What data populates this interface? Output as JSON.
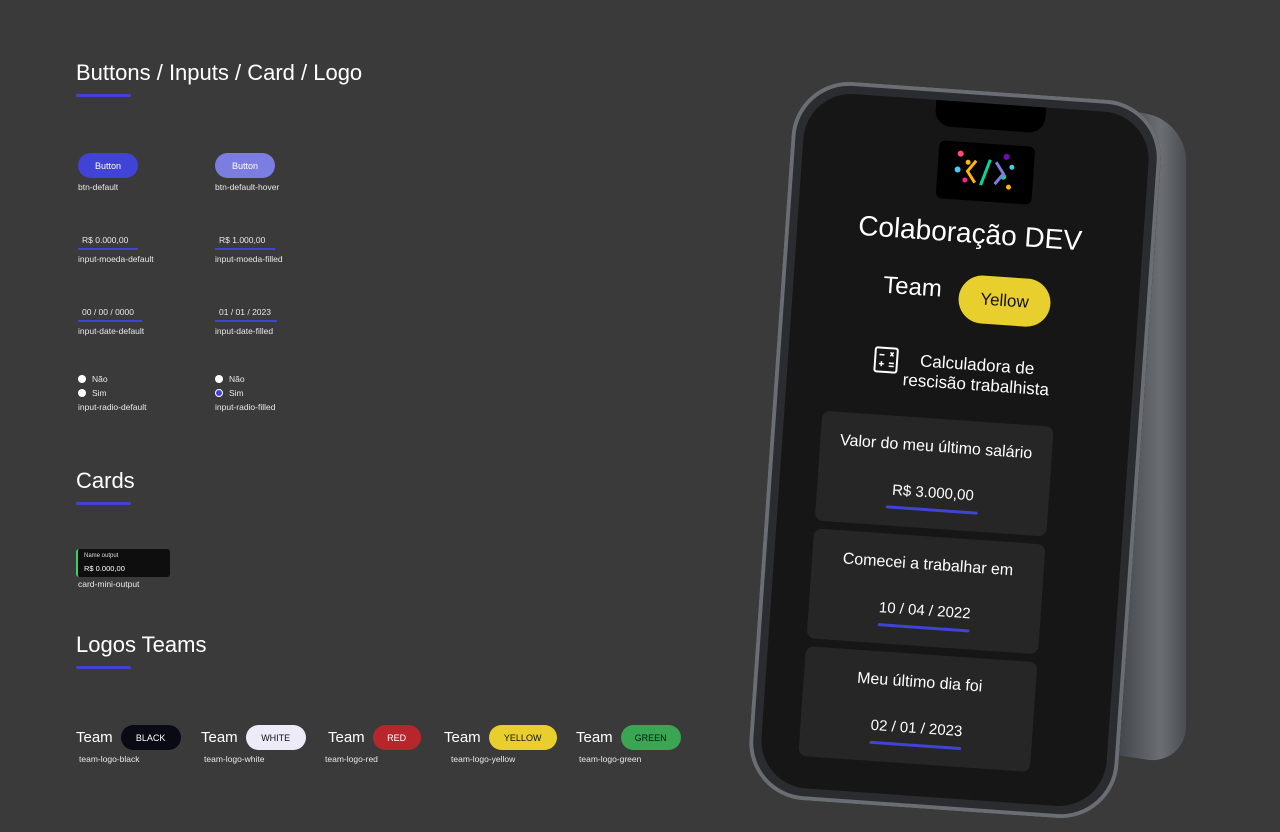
{
  "sections": {
    "buttons_inputs": "Buttons / Inputs / Card / Logo",
    "cards": "Cards",
    "logos_teams": "Logos Teams"
  },
  "buttons": {
    "default": {
      "text": "Button",
      "label": "btn-default",
      "color": "#4043d6"
    },
    "hover": {
      "text": "Button",
      "label": "btn-default-hover",
      "color": "#7b7de0"
    }
  },
  "inputs": {
    "moeda_default": {
      "value": "R$   0.000,00",
      "label": "input-moeda-default"
    },
    "moeda_filled": {
      "value": "R$   1.000,00",
      "label": "input-moeda-filled"
    },
    "date_default": {
      "value": "00 / 00 / 0000",
      "label": "input-date-default"
    },
    "date_filled": {
      "value": "01 / 01 / 2023",
      "label": "input-date-filled"
    },
    "radio_default": {
      "opt_no": "Não",
      "opt_yes": "Sim",
      "label": "input-radio-default"
    },
    "radio_filled": {
      "opt_no": "Não",
      "opt_yes": "Sim",
      "label": "input-radio-filled"
    }
  },
  "mini_card": {
    "name": "Name output",
    "value": "R$ 0.000,00",
    "label": "card-mini-output",
    "accent": "#3bd063"
  },
  "teams": {
    "word": "Team",
    "black": {
      "pill": "BLACK",
      "label": "team-logo-black",
      "color": "#0a0a14"
    },
    "white": {
      "pill": "WHITE",
      "label": "team-logo-white",
      "color": "#ecebf7"
    },
    "red": {
      "pill": "RED",
      "label": "team-logo-red",
      "color": "#b8262d"
    },
    "yellow": {
      "pill": "YELLOW",
      "label": "team-logo-yellow",
      "color": "#e9cf2d"
    },
    "green": {
      "pill": "GREEN",
      "label": "team-logo-green",
      "color": "#3aa653"
    }
  },
  "phone": {
    "title": "Colaboração DEV",
    "team_word": "Team",
    "team_pill": "Yellow",
    "calc_line1": "Calculadora de",
    "calc_line2": "rescisão trabalhista",
    "calc_icon": "calculator-icon",
    "cards": [
      {
        "label": "Valor do meu último salário",
        "value": "R$ 3.000,00"
      },
      {
        "label": "Comecei a trabalhar em",
        "value": "10 / 04 / 2022"
      },
      {
        "label": "Meu último dia foi",
        "value": "02 / 01 / 2023"
      }
    ]
  }
}
